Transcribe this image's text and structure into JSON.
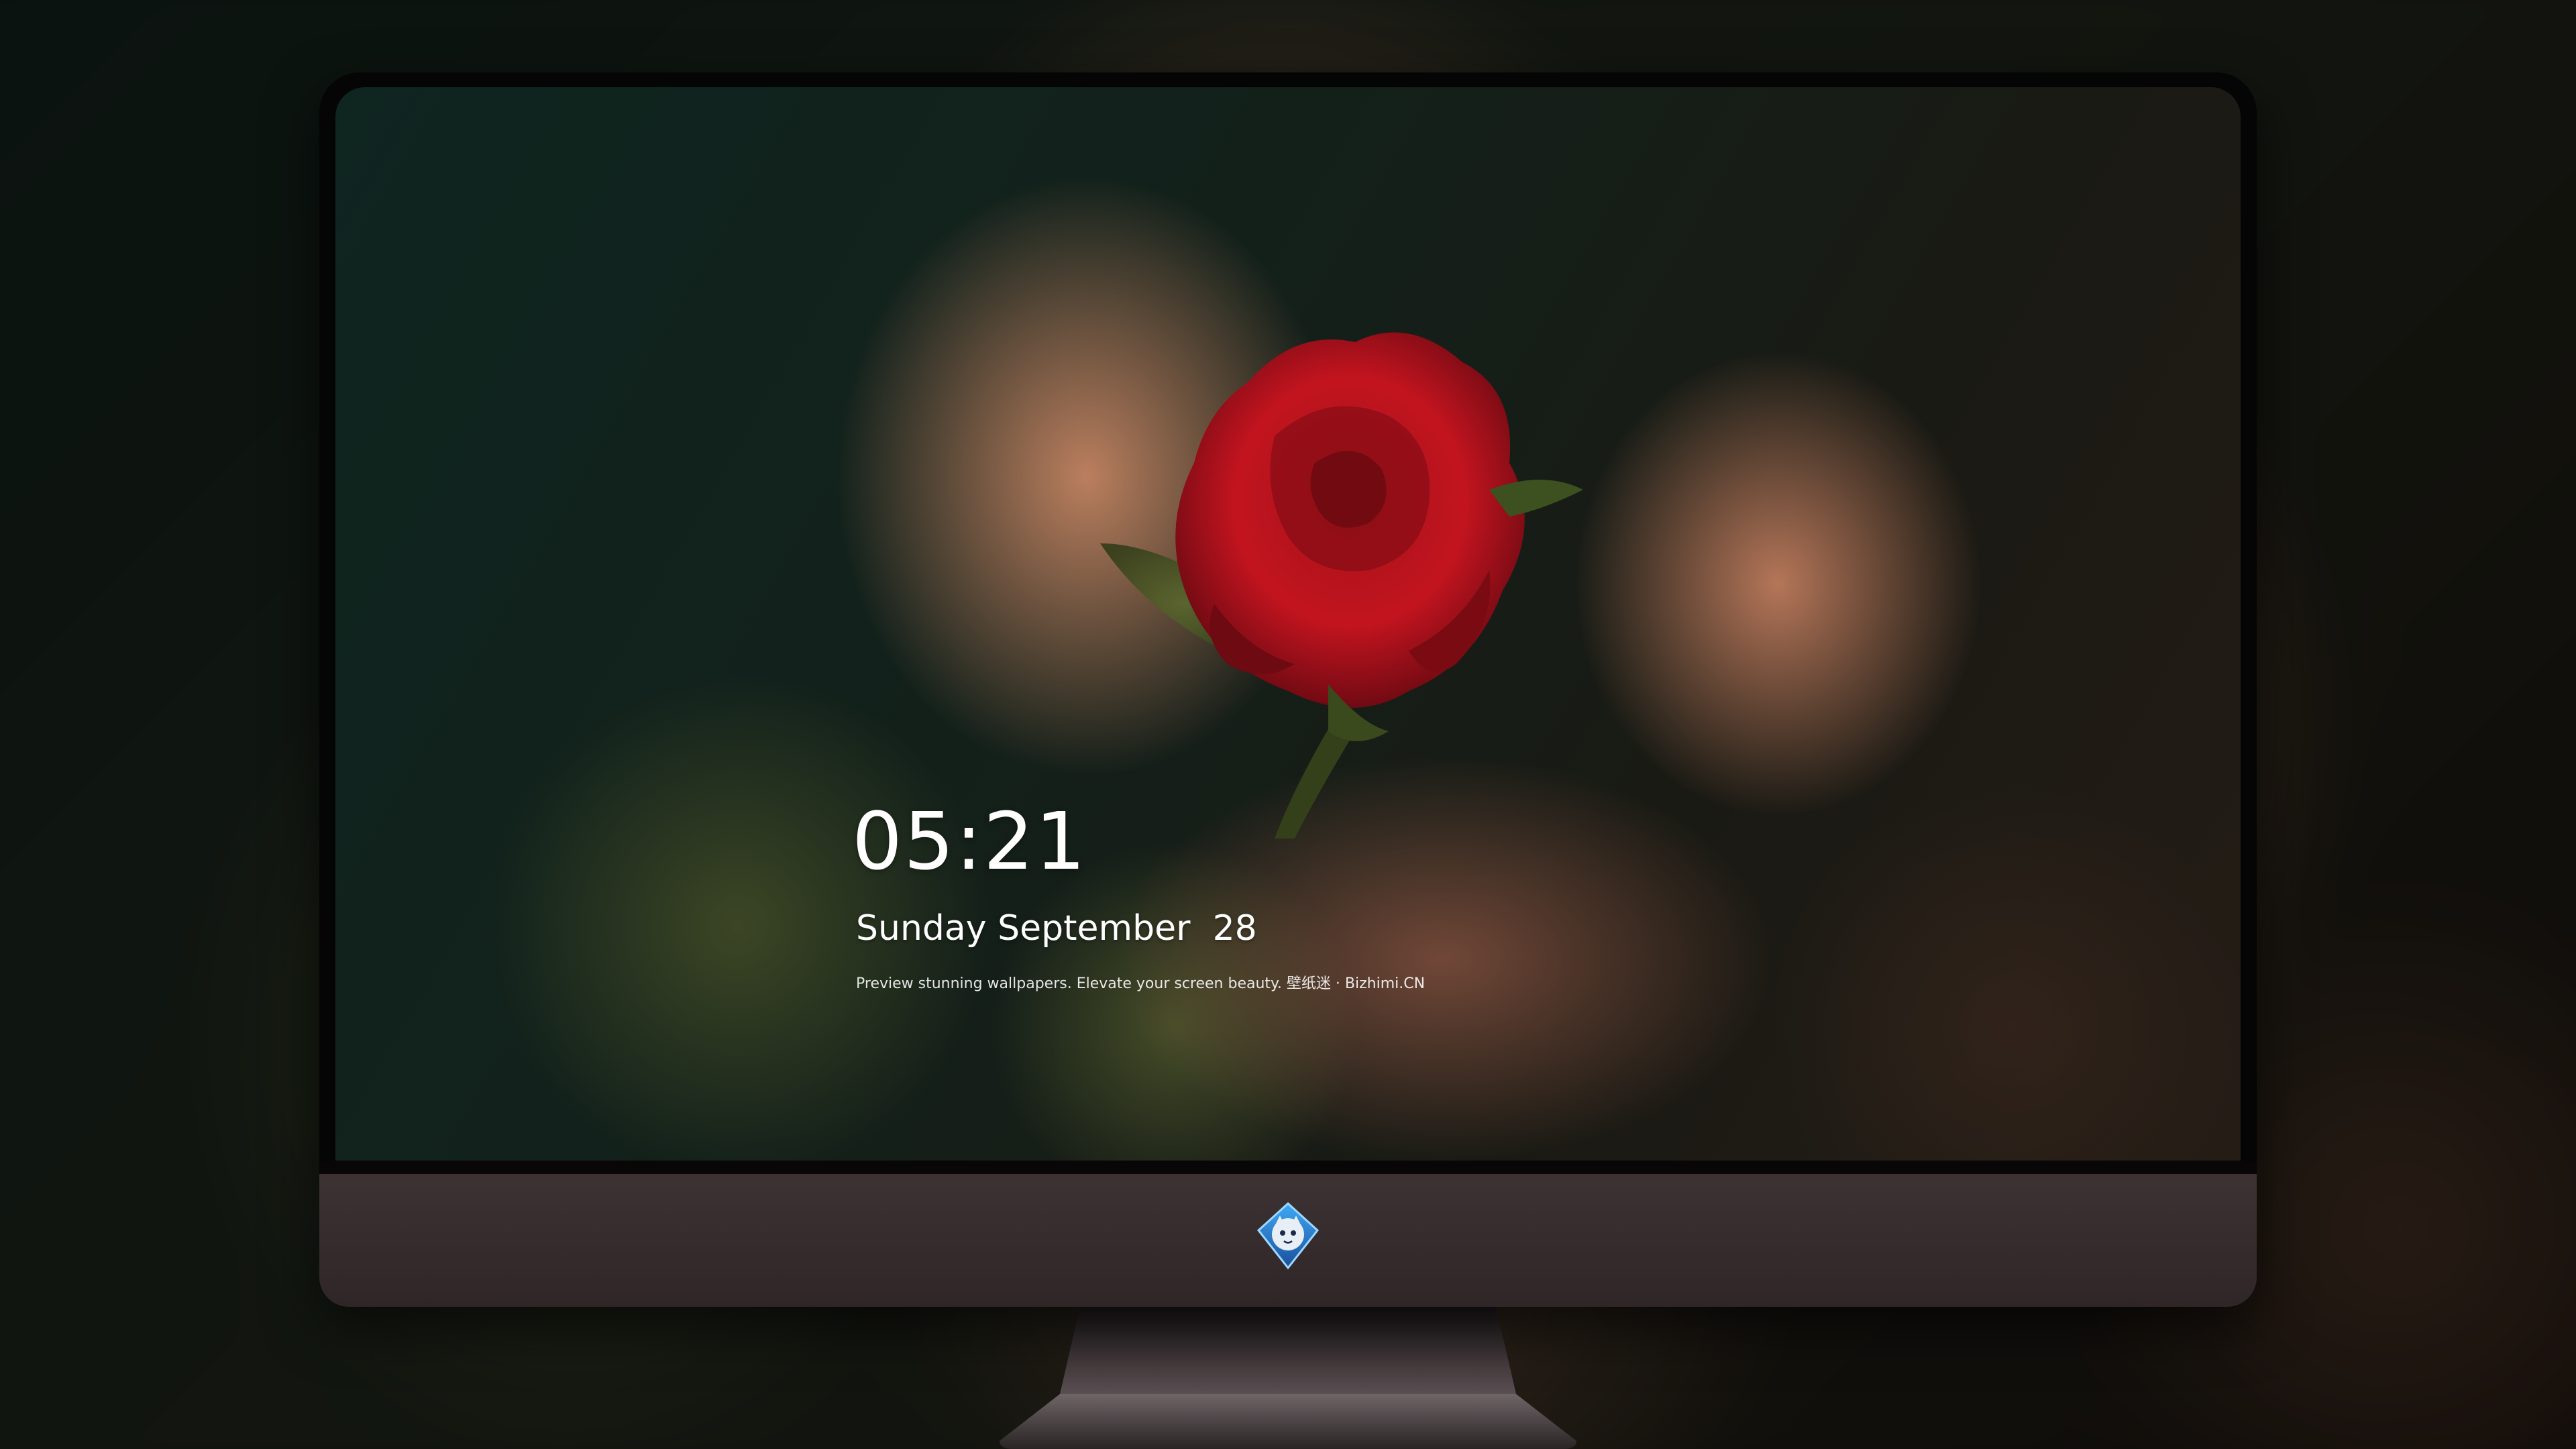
{
  "lockscreen": {
    "time": "05:21",
    "date": "Sunday September  28",
    "tagline": "Preview stunning wallpapers. Elevate your screen beauty. 壁纸迷 · Bizhimi.CN"
  },
  "dock": {
    "apps": [
      {
        "name": "messages-icon",
        "color": "#34c759"
      },
      {
        "name": "weather-icon",
        "color": "#1e7cf2"
      },
      {
        "name": "clock-icon",
        "color": "#1c1c1e"
      },
      {
        "name": "preview-icon",
        "color": "#f2c94c"
      },
      {
        "name": "clips-icon",
        "color": "#5ac8fa"
      },
      {
        "name": "notes-icon",
        "color": "#ffd43b"
      },
      {
        "name": "photo-booth-icon",
        "color": "#f5f5f5"
      },
      {
        "name": "music-icon",
        "color": "#fc5c9c"
      },
      {
        "name": "app-store-icon",
        "color": "#1a8cff"
      },
      {
        "name": "camera-icon",
        "color": "#8e8e93"
      }
    ]
  },
  "colors": {
    "bezel": "#050505",
    "chin": "#3e3335",
    "stand": "#2b2626"
  }
}
